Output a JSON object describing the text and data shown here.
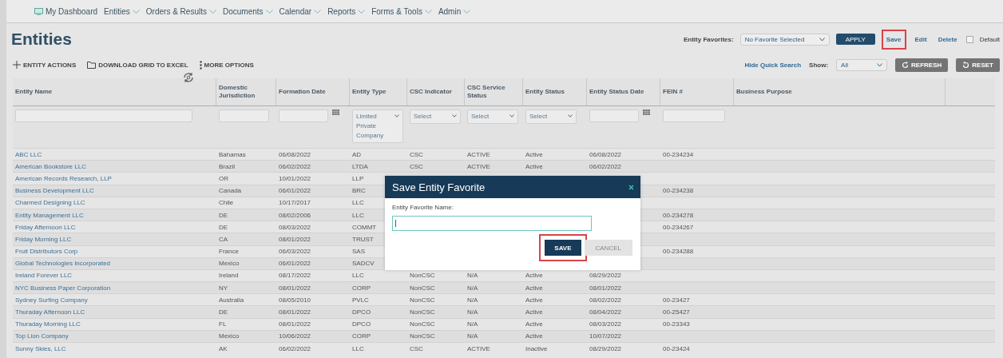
{
  "nav": {
    "items": [
      {
        "label": "My Dashboard",
        "caret": false
      },
      {
        "label": "Entities",
        "caret": true
      },
      {
        "label": "Orders & Results",
        "caret": true
      },
      {
        "label": "Documents",
        "caret": true
      },
      {
        "label": "Calendar",
        "caret": true
      },
      {
        "label": "Reports",
        "caret": true
      },
      {
        "label": "Forms & Tools",
        "caret": true
      },
      {
        "label": "Admin",
        "caret": true
      }
    ]
  },
  "title": "Entities",
  "favorites": {
    "label": "Entity Favorites:",
    "select": "No Favorite Selected",
    "apply": "APPLY",
    "links": [
      {
        "label": "Save",
        "highlighted": true
      },
      {
        "label": "Edit",
        "highlighted": false
      },
      {
        "label": "Delete",
        "highlighted": false
      }
    ],
    "default": {
      "label": "Default",
      "checked": false
    }
  },
  "actions": [
    {
      "kind": "plus",
      "label": "ENTITY ACTIONS"
    },
    {
      "kind": "folder",
      "label": "DOWNLOAD GRID TO EXCEL"
    },
    {
      "kind": "dots",
      "label": "MORE OPTIONS"
    }
  ],
  "quick": {
    "hide": "Hide Quick Search",
    "show_label": "Show:",
    "show_value": "All",
    "buttons": [
      {
        "kind": "refresh",
        "label": "REFRESH"
      },
      {
        "kind": "reset",
        "label": "RESET"
      }
    ]
  },
  "table": {
    "columns": [
      {
        "label": "Entity Name",
        "filter": {
          "kind": "text"
        }
      },
      {
        "label": "Domestic Jurisdiction",
        "filter": {
          "kind": "text"
        }
      },
      {
        "label": "Formation Date",
        "filter": {
          "kind": "date"
        }
      },
      {
        "label": "Entity Type",
        "filter": {
          "kind": "select",
          "value": "Limited Private Company"
        }
      },
      {
        "label": "CSC Indicator",
        "filter": {
          "kind": "select",
          "value": "Select"
        }
      },
      {
        "label": "CSC Service Status",
        "filter": {
          "kind": "select",
          "value": "Select"
        }
      },
      {
        "label": "Entity Status",
        "filter": {
          "kind": "select",
          "value": "Select"
        }
      },
      {
        "label": "Entity Status Date",
        "filter": {
          "kind": "date"
        }
      },
      {
        "label": "FEIN #",
        "filter": {
          "kind": "text"
        }
      },
      {
        "label": "Business Purpose",
        "filter": {
          "kind": "none"
        }
      }
    ],
    "rows": [
      {
        "cells": [
          "ABC LLC",
          "Bahamas",
          "06/08/2022",
          "AD",
          "CSC",
          "ACTIVE",
          "Active",
          "06/08/2022",
          "00-234234",
          null
        ]
      },
      {
        "cells": [
          "American Bookstore LLC",
          "Brazil",
          "06/02/2022",
          "LTDA",
          "CSC",
          "ACTIVE",
          "Active",
          "06/02/2022",
          null,
          null
        ]
      },
      {
        "cells": [
          "American Records Research, LLP",
          "OR",
          "10/01/2022",
          "LLP",
          null,
          null,
          null,
          null,
          null,
          null
        ]
      },
      {
        "cells": [
          "Business Development LLC",
          "Canada",
          "06/01/2022",
          "BRC",
          null,
          null,
          null,
          null,
          "00-234238",
          null
        ]
      },
      {
        "cells": [
          "Charmed Designing LLC",
          "Chile",
          "10/17/2017",
          "LLC",
          null,
          null,
          null,
          null,
          null,
          null
        ]
      },
      {
        "cells": [
          "Entity Management LLC",
          "DE",
          "08/02/2006",
          "LLC",
          null,
          null,
          null,
          null,
          "00-234278",
          null
        ]
      },
      {
        "cells": [
          "Friday Afternoon LLC",
          "DE",
          "08/03/2022",
          "COMMT",
          null,
          null,
          null,
          null,
          "00-234267",
          null
        ]
      },
      {
        "cells": [
          "Friday Morning LLC",
          "CA",
          "08/01/2022",
          "TRUST",
          null,
          null,
          null,
          null,
          null,
          null
        ]
      },
      {
        "cells": [
          "Fruit Distributors Corp",
          "France",
          "06/03/2022",
          "SAS",
          null,
          null,
          null,
          null,
          "00-234288",
          null
        ]
      },
      {
        "cells": [
          "Global Technologies Incorporated",
          "Mexico",
          "06/01/2022",
          "SADCV",
          null,
          null,
          null,
          null,
          null,
          null
        ]
      },
      {
        "cells": [
          "Ireland Forever LLC",
          "Ireland",
          "08/17/2022",
          "LLC",
          "NonCSC",
          "N/A",
          "Active",
          "08/29/2022",
          null,
          null
        ]
      },
      {
        "cells": [
          "NYC Business Paper Corporation",
          "NY",
          "08/01/2022",
          "CORP",
          "NonCSC",
          "N/A",
          "Active",
          "08/01/2022",
          null,
          null
        ]
      },
      {
        "cells": [
          "Sydney Surfing Company",
          "Australia",
          "08/05/2010",
          "PVLC",
          "NonCSC",
          "N/A",
          "Active",
          "08/02/2022",
          "00-23427",
          null
        ]
      },
      {
        "cells": [
          "Thuraday Afternoon LLC",
          "DE",
          "08/01/2022",
          "DPCO",
          "NonCSC",
          "N/A",
          "Active",
          "08/04/2022",
          "00-25427",
          null
        ]
      },
      {
        "cells": [
          "Thuraday Morning LLC",
          "FL",
          "08/01/2022",
          "DPCO",
          "NonCSC",
          "N/A",
          "Active",
          "08/03/2022",
          "00-23343",
          null
        ]
      },
      {
        "cells": [
          "Top Lion Company",
          "Mexico",
          "10/06/2022",
          "CORP",
          "NonCSC",
          "N/A",
          "Active",
          "10/07/2022",
          null,
          null
        ]
      },
      {
        "cells": [
          "Sunny Skies, LLC",
          "AK",
          "06/02/2022",
          "LLC",
          "CSC",
          "ACTIVE",
          "Inactive",
          "08/29/2022",
          "00-23424",
          null
        ]
      }
    ]
  },
  "modal": {
    "title": "Save Entity Favorite",
    "field_label": "Entity Favorite Name:",
    "focused": true,
    "buttons": [
      {
        "kind": "primary",
        "label": "SAVE",
        "highlighted": true
      },
      {
        "kind": "secondary",
        "label": "CANCEL",
        "highlighted": false
      }
    ]
  }
}
